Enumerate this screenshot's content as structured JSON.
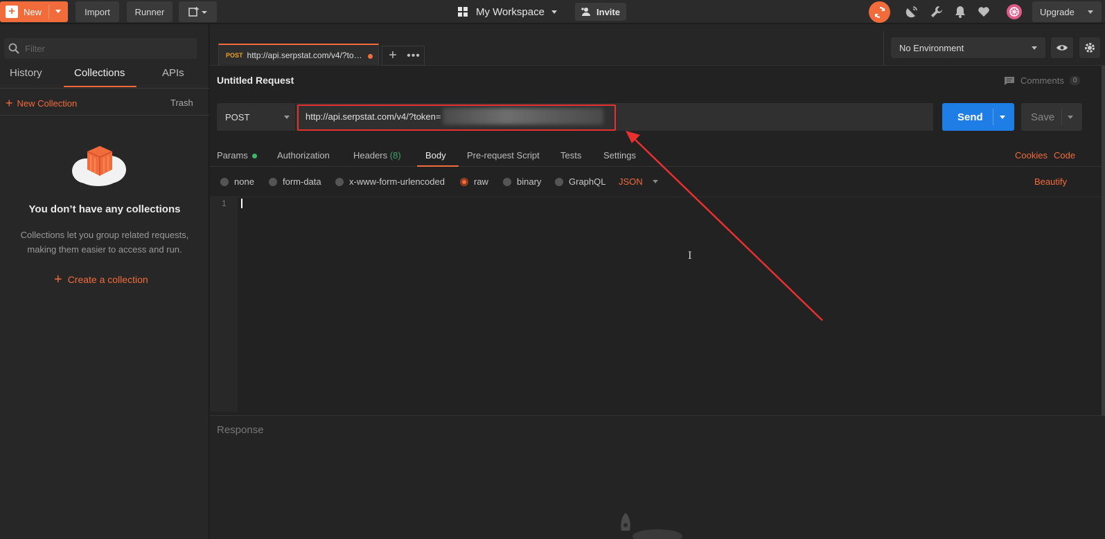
{
  "topbar": {
    "new_label": "New",
    "import_label": "Import",
    "runner_label": "Runner",
    "workspace_label": "My Workspace",
    "invite_label": "Invite",
    "upgrade_label": "Upgrade"
  },
  "sidebar": {
    "filter_placeholder": "Filter",
    "tabs": [
      {
        "label": "History"
      },
      {
        "label": "Collections"
      },
      {
        "label": "APIs"
      }
    ],
    "new_collection_label": "New Collection",
    "trash_label": "Trash",
    "empty_title": "You don’t have any collections",
    "empty_desc_line1": "Collections let you group related requests,",
    "empty_desc_line2": "making them easier to access and run.",
    "create_label": "Create a collection"
  },
  "tab": {
    "method": "POST",
    "url": "http://api.serpstat.com/v4/?to…"
  },
  "environment": {
    "selected": "No Environment"
  },
  "request": {
    "name": "Untitled Request",
    "comments_label": "Comments",
    "comments_count": "0",
    "method": "POST",
    "url": "http://api.serpstat.com/v4/?token=",
    "send_label": "Send",
    "save_label": "Save"
  },
  "request_tabs": {
    "params": "Params",
    "authorization": "Authorization",
    "headers": "Headers",
    "headers_count": "(8)",
    "body": "Body",
    "prerequest": "Pre-request Script",
    "tests": "Tests",
    "settings": "Settings",
    "cookies": "Cookies",
    "code": "Code"
  },
  "body_types": {
    "none": "none",
    "form_data": "form-data",
    "urlencoded": "x-www-form-urlencoded",
    "raw": "raw",
    "binary": "binary",
    "graphql": "GraphQL",
    "format": "JSON",
    "beautify": "Beautify"
  },
  "editor": {
    "line_number": "1"
  },
  "response": {
    "title": "Response"
  },
  "colors": {
    "accent": "#f26b3a",
    "send_blue": "#1f7ee6",
    "highlight_red": "#e8312f"
  }
}
